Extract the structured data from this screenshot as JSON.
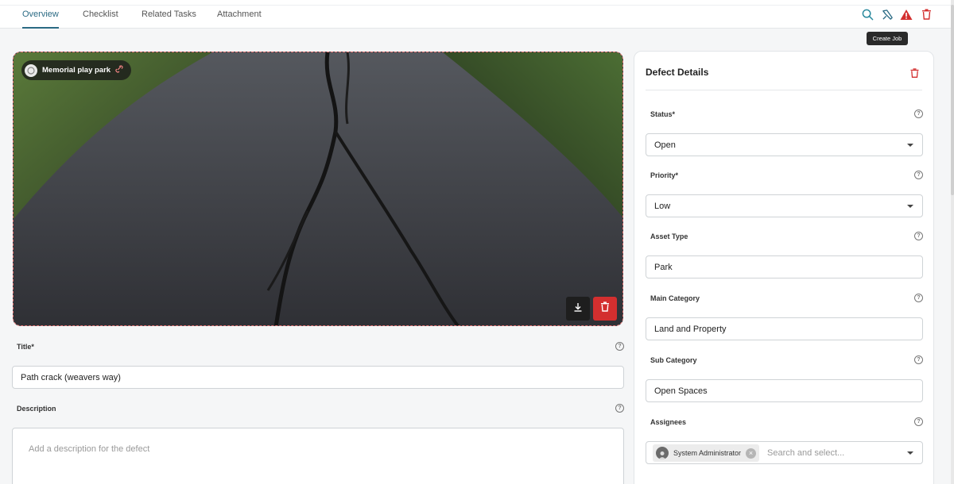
{
  "tabs": [
    {
      "label": "Overview",
      "active": true
    },
    {
      "label": "Checklist",
      "active": false
    },
    {
      "label": "Related Tasks",
      "active": false
    },
    {
      "label": "Attachment",
      "active": false
    }
  ],
  "toolbar": {
    "icons": [
      "search-icon",
      "tools-icon",
      "warning-icon",
      "trash-icon"
    ],
    "tooltip": "Create Job"
  },
  "photo": {
    "location": "Memorial play park",
    "actions": [
      "download-icon",
      "trash-icon"
    ]
  },
  "form": {
    "title_label": "Title*",
    "title_value": "Path crack (weavers way)",
    "description_label": "Description",
    "description_placeholder": "Add a description for the defect"
  },
  "panel": {
    "title": "Defect Details",
    "status_label": "Status*",
    "status_value": "Open",
    "priority_label": "Priority*",
    "priority_value": "Low",
    "asset_type_label": "Asset Type",
    "asset_type_value": "Park",
    "main_category_label": "Main Category",
    "main_category_value": "Land and Property",
    "sub_category_label": "Sub Category",
    "sub_category_value": "Open Spaces",
    "assignees_label": "Assignees",
    "assignee_chip": "System Administrator",
    "assignees_placeholder": "Search and select..."
  },
  "colors": {
    "accent": "#2b6b84",
    "danger": "#d32f2f"
  }
}
